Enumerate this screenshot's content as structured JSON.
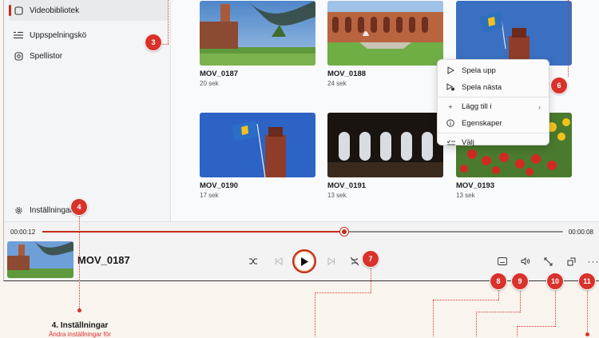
{
  "sidebar": {
    "items": [
      {
        "label": "Videobibliotek",
        "icon": "video-library-icon"
      },
      {
        "label": "Uppspelningskö",
        "icon": "queue-icon"
      },
      {
        "label": "Spellistor",
        "icon": "playlist-icon"
      }
    ],
    "settings_label": "Inställningar"
  },
  "library": {
    "tiles": [
      {
        "title": "MOV_0187",
        "duration": "20 sek"
      },
      {
        "title": "MOV_0188",
        "duration": "24 sek"
      },
      {
        "title": "",
        "duration": ""
      },
      {
        "title": "MOV_0190",
        "duration": "17 sek"
      },
      {
        "title": "MOV_0191",
        "duration": "13 sek"
      },
      {
        "title": "MOV_0193",
        "duration": "13 sek"
      }
    ]
  },
  "context_menu": {
    "items": [
      {
        "label": "Spela upp",
        "icon": "play-outline-icon"
      },
      {
        "label": "Spela nästa",
        "icon": "play-next-icon"
      },
      {
        "label": "Lägg till i",
        "icon": "add-icon",
        "submenu": true
      },
      {
        "label": "Egenskaper",
        "icon": "info-icon"
      },
      {
        "label": "Välj",
        "icon": "select-icon"
      }
    ]
  },
  "player": {
    "elapsed": "00:00:12",
    "total": "00:00:08",
    "progress": 0.58,
    "title": "MOV_0187"
  },
  "badges": [
    "3",
    "4",
    "6",
    "7",
    "8",
    "9",
    "10",
    "11"
  ],
  "annotation": {
    "title": "4. Inställningar",
    "desc": "Ändra inställningar för"
  },
  "colors": {
    "accent": "#c42b1c",
    "badge": "#d9312b"
  }
}
